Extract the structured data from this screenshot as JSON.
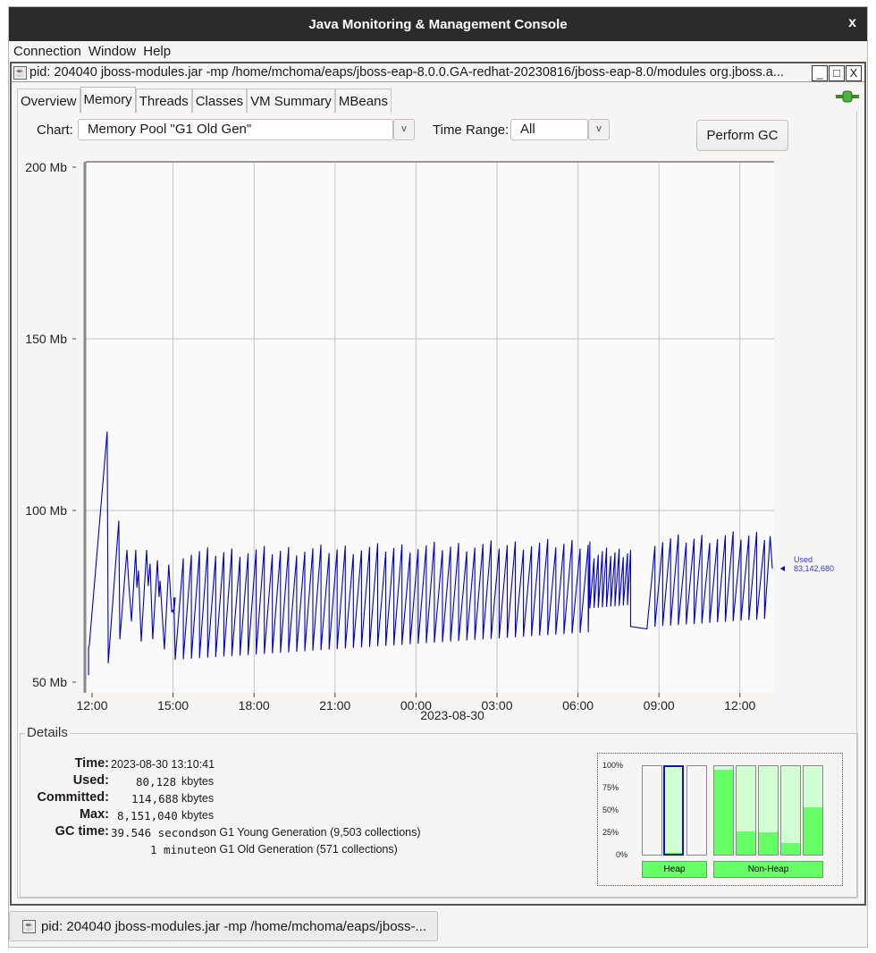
{
  "window": {
    "title": "Java Monitoring & Management Console",
    "close": "x"
  },
  "menu": [
    {
      "label": "Connection"
    },
    {
      "label": "Window"
    },
    {
      "label": "Help"
    }
  ],
  "internal_frame": {
    "title": "pid: 204040 jboss-modules.jar -mp /home/mchoma/eaps/jboss-eap-8.0.0.GA-redhat-20230816/jboss-eap-8.0/modules org.jboss.a...",
    "minimize": "_",
    "maximize": "□",
    "close": "X"
  },
  "tabs": [
    {
      "label": "Overview"
    },
    {
      "label": "Memory",
      "active": true
    },
    {
      "label": "Threads"
    },
    {
      "label": "Classes"
    },
    {
      "label": "VM Summary"
    },
    {
      "label": "MBeans"
    }
  ],
  "controls": {
    "chart_label": "Chart:",
    "chart_value": "Memory Pool \"G1 Old Gen\"",
    "time_range_label": "Time Range:",
    "time_range_value": "All",
    "dropdown_glyph": "v",
    "perform_gc": "Perform GC"
  },
  "chart_data": {
    "type": "line",
    "title": "",
    "xlabel": "2023-08-30",
    "ylabel": "",
    "x_unit": "hours since 2023-08-29 12:00",
    "x_ticks": [
      {
        "h": 0,
        "label": "12:00"
      },
      {
        "h": 3,
        "label": "15:00"
      },
      {
        "h": 6,
        "label": "18:00"
      },
      {
        "h": 9,
        "label": "21:00"
      },
      {
        "h": 12,
        "label": "00:00"
      },
      {
        "h": 15,
        "label": "03:00"
      },
      {
        "h": 18,
        "label": "06:00"
      },
      {
        "h": 21,
        "label": "09:00"
      },
      {
        "h": 24,
        "label": "12:00"
      }
    ],
    "y_ticks": [
      {
        "v": 50,
        "label": "50 Mb"
      },
      {
        "v": 100,
        "label": "100 Mb"
      },
      {
        "v": 150,
        "label": "150 Mb"
      },
      {
        "v": 200,
        "label": "200 Mb"
      }
    ],
    "xlim": [
      -0.2,
      25.25
    ],
    "ylim": [
      48,
      200.5
    ],
    "grid": true,
    "series": [
      {
        "name": "Used",
        "color": "#0000c8",
        "current_value_label": "83,142,680",
        "points": [
          [
            -0.13,
            52
          ],
          [
            -0.13,
            60
          ],
          [
            -0.1,
            61
          ],
          [
            0.56,
            123
          ],
          [
            0.6,
            55.5
          ],
          [
            0.99,
            97
          ],
          [
            1.03,
            62.5
          ],
          [
            1.29,
            88.5
          ],
          [
            1.36,
            78.5
          ],
          [
            1.46,
            67.7
          ],
          [
            1.62,
            88.5
          ],
          [
            1.66,
            77.5
          ],
          [
            1.72,
            82.5
          ],
          [
            1.82,
            61.8
          ],
          [
            2.02,
            88.5
          ],
          [
            2.08,
            78
          ],
          [
            2.15,
            84.5
          ],
          [
            2.25,
            62.5
          ],
          [
            2.42,
            85.5
          ],
          [
            2.48,
            74.8
          ],
          [
            2.52,
            79.5
          ],
          [
            2.68,
            59.5
          ],
          [
            2.84,
            84.2
          ],
          [
            2.91,
            75
          ],
          [
            2.95,
            70.5
          ],
          [
            3.0,
            71
          ],
          [
            3.03,
            70
          ],
          [
            3.08,
            74.5
          ],
          [
            3.03,
            74.5
          ]
        ],
        "sawtooth_segments": [
          {
            "start": 3.08,
            "end": 18.44,
            "period": 0.3,
            "low": [
              56.5,
              64.5
            ],
            "high": [
              87.5,
              90.5
            ]
          },
          {
            "start": 18.44,
            "end": 19.95,
            "period": 0.155,
            "low": [
              71.5,
              72.5
            ],
            "high": [
              87.5,
              88
            ]
          },
          {
            "start": 19.95,
            "end": 20.56,
            "period": 0.61,
            "low": [
              66.2,
              67
            ],
            "high": [
              66.5,
              67
            ]
          },
          {
            "start": 20.56,
            "end": 25.12,
            "period": 0.29,
            "low": [
              66,
              68.5
            ],
            "high": [
              91,
              93
            ]
          }
        ],
        "last_point": [
          25.2,
          83.1
        ]
      }
    ]
  },
  "details": {
    "title": "Details",
    "time_label": "Time:",
    "time_value": "2023-08-30 13:10:41",
    "used_label": "Used:",
    "used_value": "80,128",
    "used_unit": "kbytes",
    "committed_label": "Committed:",
    "committed_value": "114,688",
    "committed_unit": "kbytes",
    "max_label": "Max:",
    "max_value": "8,151,040",
    "max_unit": "kbytes",
    "gc_label": "GC time:",
    "gc_young_value": "39.546 seconds",
    "gc_young_text": "on G1 Young Generation (9,503 collections)",
    "gc_old_value": "1 minute",
    "gc_old_text": "on G1 Old Generation (571 collections)"
  },
  "pool_chart": {
    "ticks": [
      "100%",
      "75%",
      "50%",
      "25%",
      "0%"
    ],
    "heap_label": "Heap",
    "nonheap_label": "Non-Heap",
    "heap_bars": [
      {
        "used_pct": 0,
        "committed_pct": 0
      },
      {
        "used_pct": 1,
        "committed_pct": 100,
        "selected": true
      },
      {
        "used_pct": 0,
        "committed_pct": 0
      }
    ],
    "nonheap_bars": [
      {
        "used_pct": 96,
        "committed_pct": 100
      },
      {
        "used_pct": 26,
        "committed_pct": 100
      },
      {
        "used_pct": 25,
        "committed_pct": 100
      },
      {
        "used_pct": 13,
        "committed_pct": 100
      },
      {
        "used_pct": 54,
        "committed_pct": 100
      }
    ],
    "used_color": "#66ff66",
    "committed_color": "#d2ffd2"
  },
  "taskbar": {
    "label": "pid: 204040 jboss-modules.jar -mp /home/mchoma/eaps/jboss-..."
  }
}
